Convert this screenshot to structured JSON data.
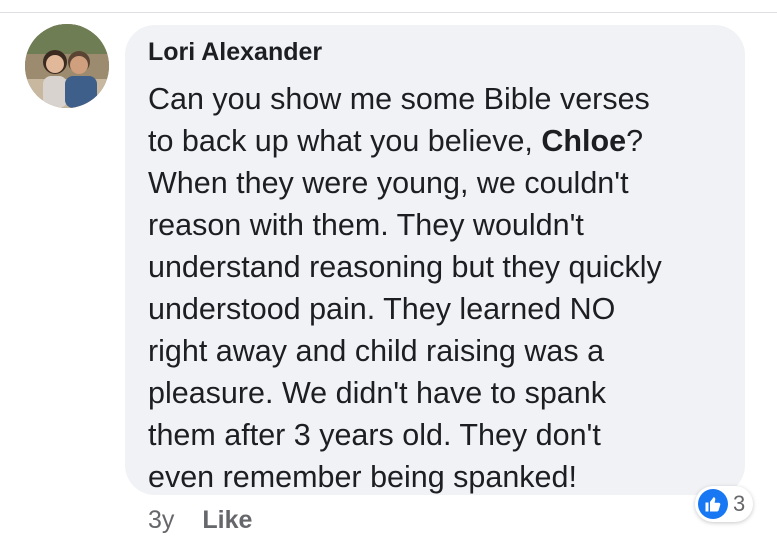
{
  "comment": {
    "author": "Lori Alexander",
    "lines": [
      {
        "text": "Can you show me some Bible verses",
        "mention": "",
        "after": ""
      },
      {
        "text": "to back up what you believe, ",
        "mention": "Chloe",
        "after": "?"
      },
      {
        "text": "When they were young, we couldn't",
        "mention": "",
        "after": ""
      },
      {
        "text": "reason with them. They wouldn't",
        "mention": "",
        "after": ""
      },
      {
        "text": "understand reasoning but they quickly",
        "mention": "",
        "after": ""
      },
      {
        "text": "understood pain. They learned NO",
        "mention": "",
        "after": ""
      },
      {
        "text": "right away and child raising was a",
        "mention": "",
        "after": ""
      },
      {
        "text": "pleasure. We didn't have to spank",
        "mention": "",
        "after": ""
      },
      {
        "text": "them after 3 years old. They don't",
        "mention": "",
        "after": ""
      },
      {
        "text": "even remember being spanked!",
        "mention": "",
        "after": ""
      }
    ]
  },
  "footer": {
    "time": "3y",
    "like_label": "Like"
  },
  "reactions": {
    "icon": "thumbs-up-icon",
    "count": "3"
  },
  "colors": {
    "bubble_bg": "#f0f2f5",
    "text": "#1c1e21",
    "meta_text": "#65676b",
    "like_blue": "#1877f2"
  }
}
